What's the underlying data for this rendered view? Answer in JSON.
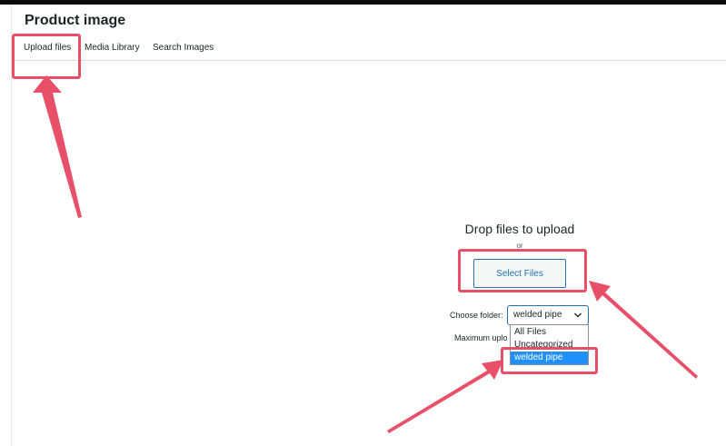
{
  "header": {
    "title": "Product image"
  },
  "tabs": [
    {
      "label": "Upload files",
      "active": true
    },
    {
      "label": "Media Library",
      "active": false
    },
    {
      "label": "Search Images",
      "active": false
    }
  ],
  "uploader": {
    "drop_title": "Drop files to upload",
    "or_text": "or",
    "select_button": "Select Files",
    "choose_folder_label": "Choose folder:",
    "folder_selected": "welded pipe",
    "folder_options": [
      "All Files",
      "Uncategorized",
      "welded pipe"
    ],
    "highlighted_option": "welded pipe",
    "max_upload_text": "Maximum uplo"
  },
  "icons": {
    "folder_select_chevron": "chevron-down-icon"
  },
  "colors": {
    "annotation": "#e8506a",
    "accent": "#2271b1",
    "highlight": "#1e90ff"
  }
}
